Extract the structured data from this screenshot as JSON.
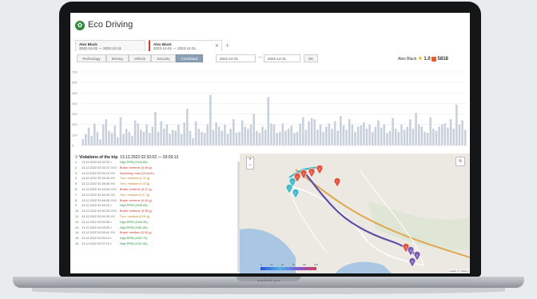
{
  "app": {
    "title": "Eco Driving"
  },
  "tabs": [
    {
      "name": "Alex Black",
      "range": "2022-12-01 — 2022-12-31"
    },
    {
      "name": "Alex Black",
      "range": "2022-12-01 — 2022-12-31"
    }
  ],
  "filters": [
    "Technology",
    "Driving",
    "Vehicle",
    "Security",
    "Combined"
  ],
  "date_from": "2022-12-01",
  "date_to": "2022-12-31",
  "ok_label": "OK",
  "user": {
    "name": "Alex Black",
    "rating": "1.0",
    "points": "5818"
  },
  "chart_data": {
    "type": "bar",
    "ylim": [
      0,
      700
    ],
    "yticks": [
      "0",
      "100",
      "200",
      "300",
      "400",
      "500",
      "600",
      "700"
    ],
    "values": [
      60,
      110,
      170,
      90,
      210,
      130,
      60,
      200,
      250,
      140,
      120,
      190,
      80,
      270,
      110,
      160,
      130,
      90,
      240,
      210,
      150,
      130,
      200,
      120,
      180,
      320,
      130,
      230,
      160,
      200,
      110,
      150,
      140,
      200,
      110,
      220,
      350,
      140,
      70,
      230,
      160,
      130,
      120,
      200,
      480,
      150,
      220,
      180,
      140,
      200,
      110,
      160,
      250,
      120,
      130,
      240,
      180,
      160,
      200,
      300,
      140,
      120,
      180,
      150,
      460,
      210,
      200,
      120,
      130,
      210,
      140,
      160,
      190,
      120,
      130,
      210,
      270,
      150,
      230,
      260,
      250,
      150,
      200,
      130,
      180,
      210,
      160,
      230,
      140,
      280,
      190,
      150,
      250,
      200,
      130,
      180,
      190,
      220,
      160,
      200,
      130,
      180,
      240,
      170,
      200,
      120,
      140,
      260,
      160,
      130,
      200,
      150,
      180,
      250,
      160,
      310,
      200,
      180,
      130,
      120,
      270,
      160,
      140,
      180,
      200,
      210,
      170,
      250,
      160,
      390,
      200,
      240,
      150
    ]
  },
  "violations": {
    "title": "Violations of the trip",
    "trip": "13.12.2022 02:32:02 — 03:03:13",
    "rows": [
      {
        "i": "1.",
        "time": "13.12.2022 02:32:02",
        "dist": "1",
        "text": "High RPM (1943.80)."
      },
      {
        "i": "2.",
        "time": "13.12.2022 02:32:22",
        "dist": "2000",
        "text": "Brake: extreme (0.49 g)"
      },
      {
        "i": "3.",
        "time": "13.12.2022 02:34:24",
        "dist": "300",
        "text": "Speeding: road (14 km/h)"
      },
      {
        "i": "4.",
        "time": "13.12.2022 02:34:34",
        "dist": "300",
        "text": "Turn: medium (0.31 g)"
      },
      {
        "i": "5.",
        "time": "13.12.2022 02:38:36",
        "dist": "300",
        "text": "Turn: medium (0.33 g)"
      },
      {
        "i": "6.",
        "time": "13.12.2022 02:44:53",
        "dist": "2000",
        "text": "Brake: extreme (0.47 g)"
      },
      {
        "i": "7.",
        "time": "13.12.2022 02:46:25",
        "dist": "300",
        "text": "Turn: medium (0.17 g)"
      },
      {
        "i": "8.",
        "time": "13.12.2022 02:48:28",
        "dist": "2000",
        "text": "Brake: extreme (0.40 g)"
      },
      {
        "i": "9.",
        "time": "13.12.2022 02:49:23",
        "dist": "1",
        "text": "High RPM (1945.90)."
      },
      {
        "i": "10.",
        "time": "13.12.2022 02:50:29",
        "dist": "2000",
        "text": "Brake: extreme (0.39 g)"
      },
      {
        "i": "11.",
        "time": "13.12.2022 02:51:05",
        "dist": "300",
        "text": "Turn: medium (0.31 g)"
      },
      {
        "i": "12.",
        "time": "13.12.2022 02:52:08",
        "dist": "1",
        "text": "High RPM (1949.90)."
      },
      {
        "i": "13.",
        "time": "13.12.2022 02:53:09",
        "dist": "1",
        "text": "High RPM (1951.80)."
      },
      {
        "i": "14.",
        "time": "13.12.2022 02:53:42",
        "dist": "300",
        "text": "Brake: medium (0.30 g)"
      },
      {
        "i": "15.",
        "time": "13.12.2022 02:55:14",
        "dist": "1",
        "text": "High RPM (1922.70)."
      },
      {
        "i": "16.",
        "time": "13.12.2022 02:57:19",
        "dist": "1",
        "text": "High RPM (1941.50)."
      }
    ]
  },
  "map": {
    "zoom_in": "+",
    "zoom_out": "−",
    "legend_ticks": [
      "0",
      "20",
      "40",
      "60",
      "80",
      "100"
    ],
    "attribution": "Leaflet | © Wialon",
    "markers": [
      {
        "label": "1",
        "color": "#3fb9c9"
      },
      {
        "label": "2",
        "color": "#3fb9c9"
      },
      {
        "label": "3",
        "color": "#e0553f"
      },
      {
        "label": "4",
        "color": "#e0553f"
      },
      {
        "label": "5",
        "color": "#e0553f"
      },
      {
        "label": "6",
        "color": "#e0553f"
      },
      {
        "label": "7",
        "color": "#e0553f"
      },
      {
        "label": "8",
        "color": "#3fb9c9"
      },
      {
        "label": "9",
        "color": "#e0553f"
      },
      {
        "label": "10",
        "color": "#7a5bb0"
      },
      {
        "label": "11",
        "color": "#7a5bb0"
      },
      {
        "label": "12",
        "color": "#7a5bb0"
      }
    ]
  },
  "laptop_brand": "macbook pro"
}
